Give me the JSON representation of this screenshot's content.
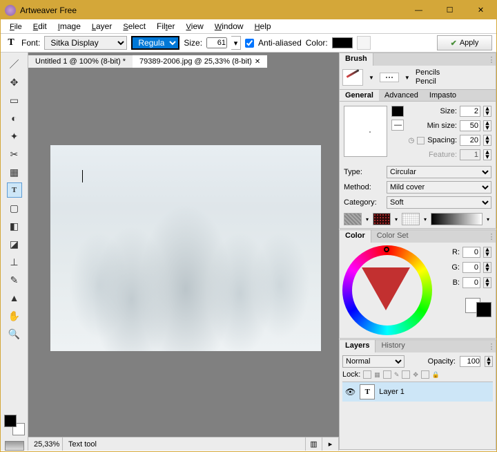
{
  "app": {
    "title": "Artweaver Free"
  },
  "menu": {
    "file": "File",
    "edit": "Edit",
    "image": "Image",
    "layer": "Layer",
    "select": "Select",
    "filter": "Filter",
    "view": "View",
    "window": "Window",
    "help": "Help"
  },
  "options": {
    "font_label": "Font:",
    "font_value": "Sitka Display",
    "style_value": "Regular",
    "size_label": "Size:",
    "size_value": "61",
    "aa_label": "Anti-aliased",
    "aa_checked": true,
    "color_label": "Color:",
    "color_value": "#000000",
    "apply_label": "Apply"
  },
  "tabs": {
    "inactive": "Untitled 1 @ 100% (8-bit) *",
    "active": "79389-2006.jpg @ 25,33% (8-bit)"
  },
  "status": {
    "zoom": "25,33%",
    "tool": "Text tool"
  },
  "brush": {
    "panel_title": "Brush",
    "variant_group": "Pencils",
    "variant_name": "Pencil",
    "tabs": {
      "general": "General",
      "advanced": "Advanced",
      "impasto": "Impasto"
    },
    "size_label": "Size:",
    "size_value": "2",
    "minsize_label": "Min size:",
    "minsize_value": "50",
    "spacing_label": "Spacing:",
    "spacing_value": "20",
    "feature_label": "Feature:",
    "feature_value": "1",
    "type_label": "Type:",
    "type_value": "Circular",
    "method_label": "Method:",
    "method_value": "Mild cover",
    "category_label": "Category:",
    "category_value": "Soft"
  },
  "color": {
    "panel_title": "Color",
    "set_tab": "Color Set",
    "r_label": "R:",
    "r_value": "0",
    "g_label": "G:",
    "g_value": "0",
    "b_label": "B:",
    "b_value": "0"
  },
  "layers": {
    "panel_title": "Layers",
    "history_tab": "History",
    "blend_value": "Normal",
    "opacity_label": "Opacity:",
    "opacity_value": "100",
    "lock_label": "Lock:",
    "layer1_name": "Layer 1"
  }
}
